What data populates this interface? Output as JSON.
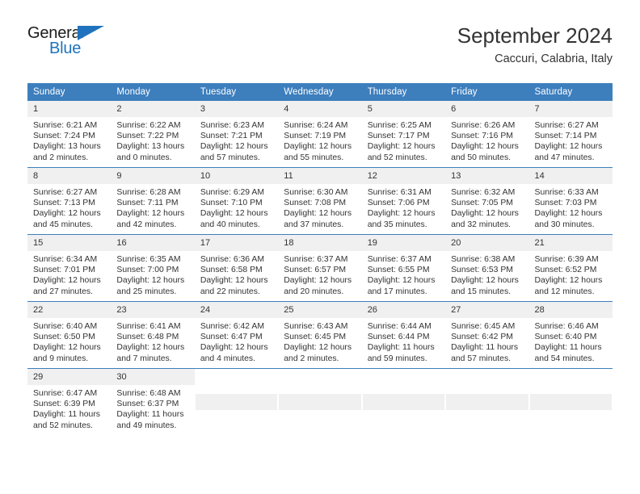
{
  "brand": {
    "name_part1": "General",
    "name_part2": "Blue",
    "accent_color": "#1f73be"
  },
  "header": {
    "title": "September 2024",
    "subtitle": "Caccuri, Calabria, Italy"
  },
  "theme": {
    "header_blue": "#3d7ebd",
    "daynum_bg": "#f0f0f0",
    "text": "#333333"
  },
  "weekday_headers": [
    "Sunday",
    "Monday",
    "Tuesday",
    "Wednesday",
    "Thursday",
    "Friday",
    "Saturday"
  ],
  "labels": {
    "sunrise_prefix": "Sunrise:",
    "sunset_prefix": "Sunset:",
    "daylight_prefix": "Daylight:"
  },
  "weeks": [
    [
      {
        "day": "1",
        "sunrise": "Sunrise: 6:21 AM",
        "sunset": "Sunset: 7:24 PM",
        "daylight_line1": "Daylight: 13 hours",
        "daylight_line2": "and 2 minutes."
      },
      {
        "day": "2",
        "sunrise": "Sunrise: 6:22 AM",
        "sunset": "Sunset: 7:22 PM",
        "daylight_line1": "Daylight: 13 hours",
        "daylight_line2": "and 0 minutes."
      },
      {
        "day": "3",
        "sunrise": "Sunrise: 6:23 AM",
        "sunset": "Sunset: 7:21 PM",
        "daylight_line1": "Daylight: 12 hours",
        "daylight_line2": "and 57 minutes."
      },
      {
        "day": "4",
        "sunrise": "Sunrise: 6:24 AM",
        "sunset": "Sunset: 7:19 PM",
        "daylight_line1": "Daylight: 12 hours",
        "daylight_line2": "and 55 minutes."
      },
      {
        "day": "5",
        "sunrise": "Sunrise: 6:25 AM",
        "sunset": "Sunset: 7:17 PM",
        "daylight_line1": "Daylight: 12 hours",
        "daylight_line2": "and 52 minutes."
      },
      {
        "day": "6",
        "sunrise": "Sunrise: 6:26 AM",
        "sunset": "Sunset: 7:16 PM",
        "daylight_line1": "Daylight: 12 hours",
        "daylight_line2": "and 50 minutes."
      },
      {
        "day": "7",
        "sunrise": "Sunrise: 6:27 AM",
        "sunset": "Sunset: 7:14 PM",
        "daylight_line1": "Daylight: 12 hours",
        "daylight_line2": "and 47 minutes."
      }
    ],
    [
      {
        "day": "8",
        "sunrise": "Sunrise: 6:27 AM",
        "sunset": "Sunset: 7:13 PM",
        "daylight_line1": "Daylight: 12 hours",
        "daylight_line2": "and 45 minutes."
      },
      {
        "day": "9",
        "sunrise": "Sunrise: 6:28 AM",
        "sunset": "Sunset: 7:11 PM",
        "daylight_line1": "Daylight: 12 hours",
        "daylight_line2": "and 42 minutes."
      },
      {
        "day": "10",
        "sunrise": "Sunrise: 6:29 AM",
        "sunset": "Sunset: 7:10 PM",
        "daylight_line1": "Daylight: 12 hours",
        "daylight_line2": "and 40 minutes."
      },
      {
        "day": "11",
        "sunrise": "Sunrise: 6:30 AM",
        "sunset": "Sunset: 7:08 PM",
        "daylight_line1": "Daylight: 12 hours",
        "daylight_line2": "and 37 minutes."
      },
      {
        "day": "12",
        "sunrise": "Sunrise: 6:31 AM",
        "sunset": "Sunset: 7:06 PM",
        "daylight_line1": "Daylight: 12 hours",
        "daylight_line2": "and 35 minutes."
      },
      {
        "day": "13",
        "sunrise": "Sunrise: 6:32 AM",
        "sunset": "Sunset: 7:05 PM",
        "daylight_line1": "Daylight: 12 hours",
        "daylight_line2": "and 32 minutes."
      },
      {
        "day": "14",
        "sunrise": "Sunrise: 6:33 AM",
        "sunset": "Sunset: 7:03 PM",
        "daylight_line1": "Daylight: 12 hours",
        "daylight_line2": "and 30 minutes."
      }
    ],
    [
      {
        "day": "15",
        "sunrise": "Sunrise: 6:34 AM",
        "sunset": "Sunset: 7:01 PM",
        "daylight_line1": "Daylight: 12 hours",
        "daylight_line2": "and 27 minutes."
      },
      {
        "day": "16",
        "sunrise": "Sunrise: 6:35 AM",
        "sunset": "Sunset: 7:00 PM",
        "daylight_line1": "Daylight: 12 hours",
        "daylight_line2": "and 25 minutes."
      },
      {
        "day": "17",
        "sunrise": "Sunrise: 6:36 AM",
        "sunset": "Sunset: 6:58 PM",
        "daylight_line1": "Daylight: 12 hours",
        "daylight_line2": "and 22 minutes."
      },
      {
        "day": "18",
        "sunrise": "Sunrise: 6:37 AM",
        "sunset": "Sunset: 6:57 PM",
        "daylight_line1": "Daylight: 12 hours",
        "daylight_line2": "and 20 minutes."
      },
      {
        "day": "19",
        "sunrise": "Sunrise: 6:37 AM",
        "sunset": "Sunset: 6:55 PM",
        "daylight_line1": "Daylight: 12 hours",
        "daylight_line2": "and 17 minutes."
      },
      {
        "day": "20",
        "sunrise": "Sunrise: 6:38 AM",
        "sunset": "Sunset: 6:53 PM",
        "daylight_line1": "Daylight: 12 hours",
        "daylight_line2": "and 15 minutes."
      },
      {
        "day": "21",
        "sunrise": "Sunrise: 6:39 AM",
        "sunset": "Sunset: 6:52 PM",
        "daylight_line1": "Daylight: 12 hours",
        "daylight_line2": "and 12 minutes."
      }
    ],
    [
      {
        "day": "22",
        "sunrise": "Sunrise: 6:40 AM",
        "sunset": "Sunset: 6:50 PM",
        "daylight_line1": "Daylight: 12 hours",
        "daylight_line2": "and 9 minutes."
      },
      {
        "day": "23",
        "sunrise": "Sunrise: 6:41 AM",
        "sunset": "Sunset: 6:48 PM",
        "daylight_line1": "Daylight: 12 hours",
        "daylight_line2": "and 7 minutes."
      },
      {
        "day": "24",
        "sunrise": "Sunrise: 6:42 AM",
        "sunset": "Sunset: 6:47 PM",
        "daylight_line1": "Daylight: 12 hours",
        "daylight_line2": "and 4 minutes."
      },
      {
        "day": "25",
        "sunrise": "Sunrise: 6:43 AM",
        "sunset": "Sunset: 6:45 PM",
        "daylight_line1": "Daylight: 12 hours",
        "daylight_line2": "and 2 minutes."
      },
      {
        "day": "26",
        "sunrise": "Sunrise: 6:44 AM",
        "sunset": "Sunset: 6:44 PM",
        "daylight_line1": "Daylight: 11 hours",
        "daylight_line2": "and 59 minutes."
      },
      {
        "day": "27",
        "sunrise": "Sunrise: 6:45 AM",
        "sunset": "Sunset: 6:42 PM",
        "daylight_line1": "Daylight: 11 hours",
        "daylight_line2": "and 57 minutes."
      },
      {
        "day": "28",
        "sunrise": "Sunrise: 6:46 AM",
        "sunset": "Sunset: 6:40 PM",
        "daylight_line1": "Daylight: 11 hours",
        "daylight_line2": "and 54 minutes."
      }
    ],
    [
      {
        "day": "29",
        "sunrise": "Sunrise: 6:47 AM",
        "sunset": "Sunset: 6:39 PM",
        "daylight_line1": "Daylight: 11 hours",
        "daylight_line2": "and 52 minutes."
      },
      {
        "day": "30",
        "sunrise": "Sunrise: 6:48 AM",
        "sunset": "Sunset: 6:37 PM",
        "daylight_line1": "Daylight: 11 hours",
        "daylight_line2": "and 49 minutes."
      },
      null,
      null,
      null,
      null,
      null
    ]
  ]
}
